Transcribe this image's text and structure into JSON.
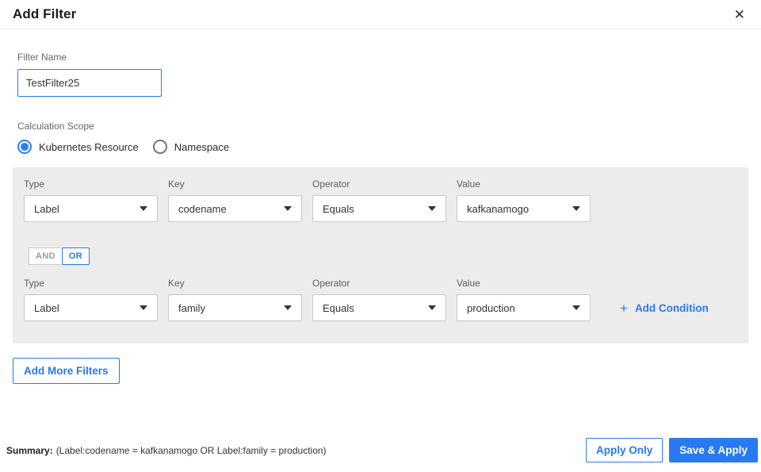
{
  "modal": {
    "title": "Add Filter",
    "close_icon": "✕"
  },
  "filter_name": {
    "label": "Filter Name",
    "value": "TestFilter25"
  },
  "calculation_scope": {
    "label": "Calculation Scope",
    "options": [
      {
        "label": "Kubernetes Resource",
        "selected": true
      },
      {
        "label": "Namespace",
        "selected": false
      }
    ]
  },
  "conditions": {
    "rows": [
      {
        "fields": [
          {
            "label": "Type",
            "value": "Label"
          },
          {
            "label": "Key",
            "value": "codename"
          },
          {
            "label": "Operator",
            "value": "Equals"
          },
          {
            "label": "Value",
            "value": "kafkanamogo"
          }
        ]
      },
      {
        "fields": [
          {
            "label": "Type",
            "value": "Label"
          },
          {
            "label": "Key",
            "value": "family"
          },
          {
            "label": "Operator",
            "value": "Equals"
          },
          {
            "label": "Value",
            "value": "production"
          }
        ]
      }
    ],
    "logic_toggle": {
      "and_label": "AND",
      "or_label": "OR",
      "selected": "OR"
    },
    "add_condition": {
      "plus_icon": "+",
      "label": "Add Condition"
    }
  },
  "add_more_filters_label": "Add More Filters",
  "footer": {
    "summary_label": "Summary:",
    "summary_text": "(Label:codename = kafkanamogo OR Label:family = production)",
    "apply_only_label": "Apply Only",
    "save_apply_label": "Save & Apply"
  },
  "colors": {
    "accent_blue": "#2879f2",
    "panel_bg": "#ececec",
    "border_gray": "#c9c9c9"
  }
}
